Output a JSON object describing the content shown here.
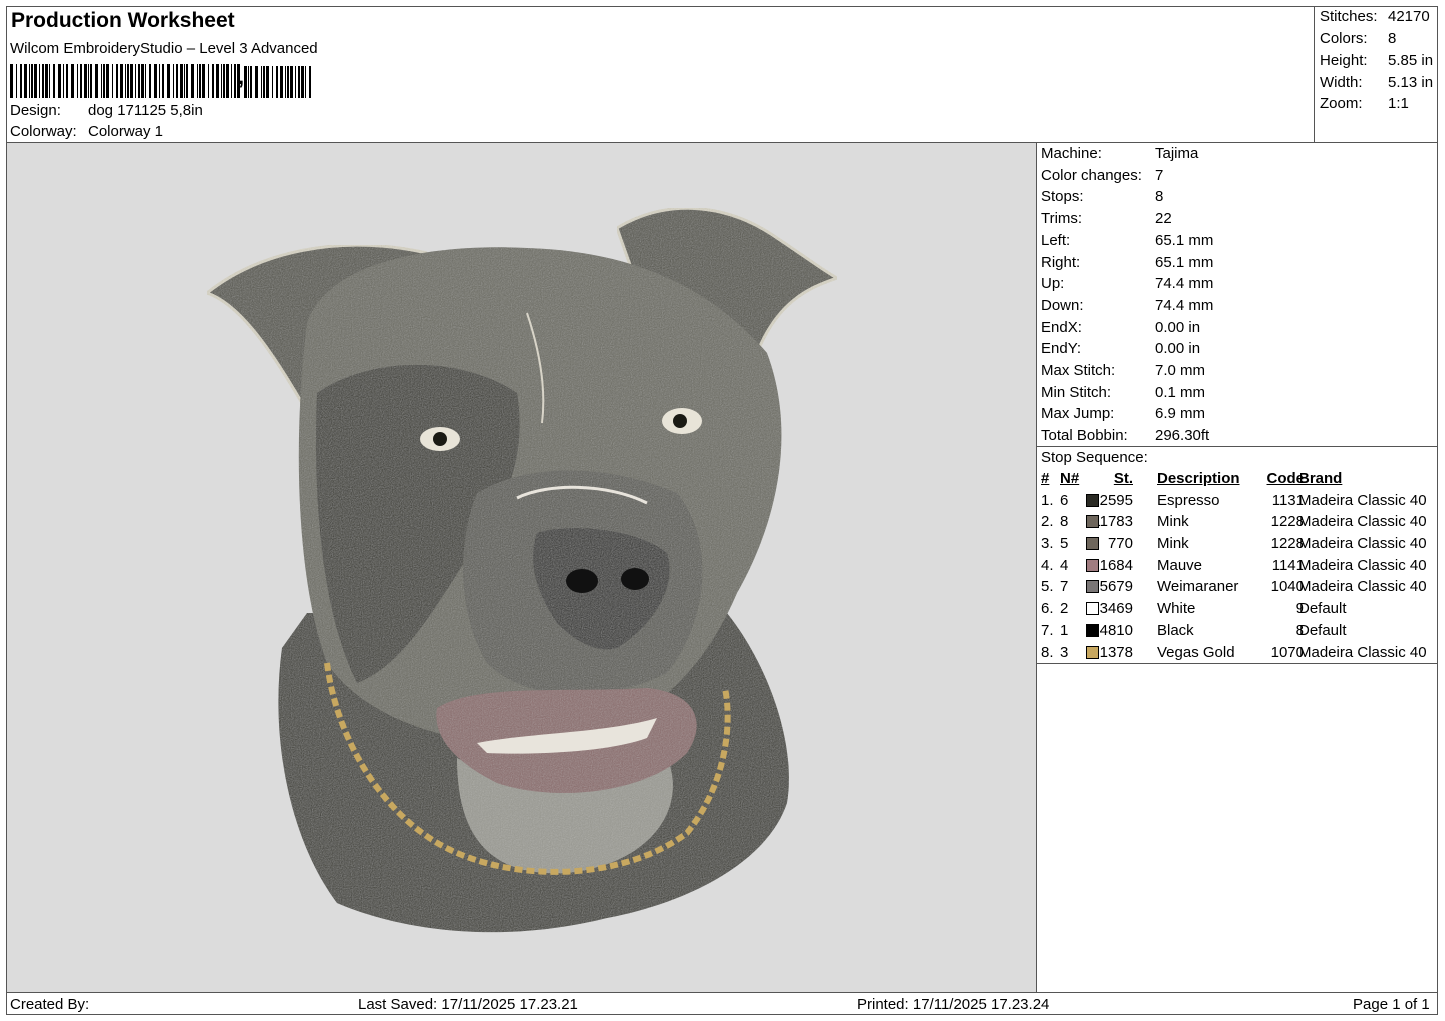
{
  "header": {
    "title": "Production Worksheet",
    "software": "Wilcom EmbroideryStudio – Level 3 Advanced",
    "barcode_suffix": ",",
    "design_label": "Design:",
    "design_value": "dog 171125 5,8in",
    "colorway_label": "Colorway:",
    "colorway_value": "Colorway 1"
  },
  "summary": [
    {
      "label": "Stitches:",
      "value": "42170"
    },
    {
      "label": "Colors:",
      "value": "8"
    },
    {
      "label": "Height:",
      "value": "5.85 in"
    },
    {
      "label": "Width:",
      "value": "5.13 in"
    },
    {
      "label": "Zoom:",
      "value": "1:1"
    }
  ],
  "machine_info": [
    {
      "label": "Machine:",
      "value": "Tajima"
    },
    {
      "label": "Color changes:",
      "value": "7"
    },
    {
      "label": "Stops:",
      "value": "8"
    },
    {
      "label": "Trims:",
      "value": "22"
    },
    {
      "label": "Left:",
      "value": "65.1 mm"
    },
    {
      "label": "Right:",
      "value": "65.1 mm"
    },
    {
      "label": "Up:",
      "value": "74.4 mm"
    },
    {
      "label": "Down:",
      "value": "74.4 mm"
    },
    {
      "label": "EndX:",
      "value": "0.00 in"
    },
    {
      "label": "EndY:",
      "value": "0.00 in"
    },
    {
      "label": "Max Stitch:",
      "value": "7.0 mm"
    },
    {
      "label": "Min Stitch:",
      "value": "0.1 mm"
    },
    {
      "label": "Max Jump:",
      "value": "6.9 mm"
    },
    {
      "label": "Total Bobbin:",
      "value": "296.30ft"
    }
  ],
  "stop_sequence": {
    "title": "Stop Sequence:",
    "headers": {
      "idx": "#",
      "n": "N#",
      "st": "St.",
      "desc": "Description",
      "code": "Code",
      "brand": "Brand"
    },
    "rows": [
      {
        "idx": "1.",
        "n": "6",
        "color": "#2a2a24",
        "st": "12595",
        "desc": "Espresso",
        "code": "1131",
        "brand": "Madeira Classic 40"
      },
      {
        "idx": "2.",
        "n": "8",
        "color": "#6e665c",
        "st": "11783",
        "desc": "Mink",
        "code": "1228",
        "brand": "Madeira Classic 40"
      },
      {
        "idx": "3.",
        "n": "5",
        "color": "#6e665c",
        "st": "770",
        "desc": "Mink",
        "code": "1228",
        "brand": "Madeira Classic 40"
      },
      {
        "idx": "4.",
        "n": "4",
        "color": "#a07c80",
        "st": "1684",
        "desc": "Mauve",
        "code": "1141",
        "brand": "Madeira Classic 40"
      },
      {
        "idx": "5.",
        "n": "7",
        "color": "#7a7676",
        "st": "5679",
        "desc": "Weimaraner",
        "code": "1040",
        "brand": "Madeira Classic 40"
      },
      {
        "idx": "6.",
        "n": "2",
        "color": "#ffffff",
        "st": "3469",
        "desc": "White",
        "code": "9",
        "brand": "Default"
      },
      {
        "idx": "7.",
        "n": "1",
        "color": "#000000",
        "st": "4810",
        "desc": "Black",
        "code": "8",
        "brand": "Default"
      },
      {
        "idx": "8.",
        "n": "3",
        "color": "#c8a860",
        "st": "1378",
        "desc": "Vegas Gold",
        "code": "1070",
        "brand": "Madeira Classic 40"
      }
    ]
  },
  "footer": {
    "created_by": "Created By:",
    "last_saved": "Last Saved: 17/11/2025 17.23.21",
    "printed": "Printed: 17/11/2025 17.23.24",
    "page": "Page 1 of 1"
  }
}
